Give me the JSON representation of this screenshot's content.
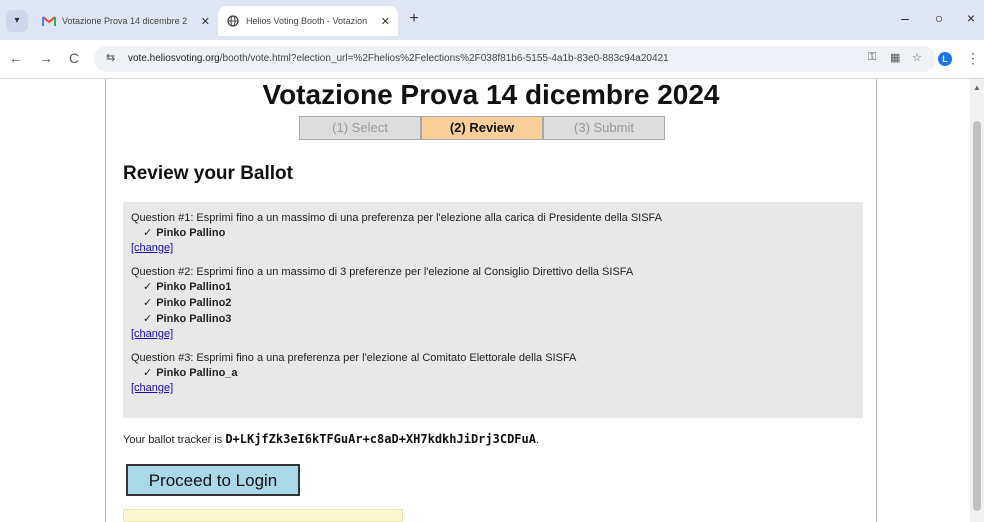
{
  "browser": {
    "tab_list_icon": "chevron-down-icon",
    "tabs": [
      {
        "label": "Votazione Prova 14 dicembre 2",
        "icon": "gmail-icon",
        "active": false
      },
      {
        "label": "Helios Voting Booth - Votazion",
        "icon": "globe-icon",
        "active": true
      }
    ],
    "new_tab_symbol": "+",
    "window_controls": {
      "minimize": "–",
      "maximize": "○",
      "close": "×"
    },
    "nav": {
      "back": "←",
      "forward": "→",
      "reload": "C"
    },
    "url_host": "vote.heliosvoting.org",
    "url_rest": "/booth/vote.html?election_url=%2Fhelios%2Felections%2F038f81b6-5155-4a1b-83e0-883c94a20421",
    "profile_initial": "L"
  },
  "booth": {
    "title": "Votazione Prova 14 dicembre 2024",
    "steps": [
      {
        "label": "(1) Select",
        "state": "inactive"
      },
      {
        "label": "(2) Review",
        "state": "active"
      },
      {
        "label": "(3) Submit",
        "state": "inactive"
      }
    ],
    "subtitle": "Review your Ballot",
    "questions": [
      {
        "text": "Question #1: Esprimi fino a un massimo di una preferenza per l'elezione alla carica di Presidente della SISFA",
        "choices": [
          "Pinko Pallino"
        ],
        "change_label": "[change]"
      },
      {
        "text": "Question #2: Esprimi fino a un massimo di 3 preferenze per l'elezione al Consiglio Direttivo della SISFA",
        "choices": [
          "Pinko Pallino1",
          "Pinko Pallino2",
          "Pinko Pallino3"
        ],
        "change_label": "[change]"
      },
      {
        "text": "Question #3: Esprimi fino a una preferenza per l'elezione al Comitato Elettorale della SISFA",
        "choices": [
          "Pinko Pallino_a"
        ],
        "change_label": "[change]"
      }
    ],
    "check_mark": "✓",
    "tracker_prefix": "Your ballot tracker is ",
    "tracker_code": "D+LKjfZk3eI6kTFGuAr+c8aD+XH7kdkhJiDrj3CDFuA",
    "tracker_suffix": ".",
    "proceed_label": "Proceed to Login"
  },
  "colors": {
    "active_step": "#fbcf9a",
    "inactive_step": "#dddddd",
    "summary_bg": "#e8e8e8",
    "proceed_bg": "#a9d9e8",
    "link": "#1a0dab"
  }
}
